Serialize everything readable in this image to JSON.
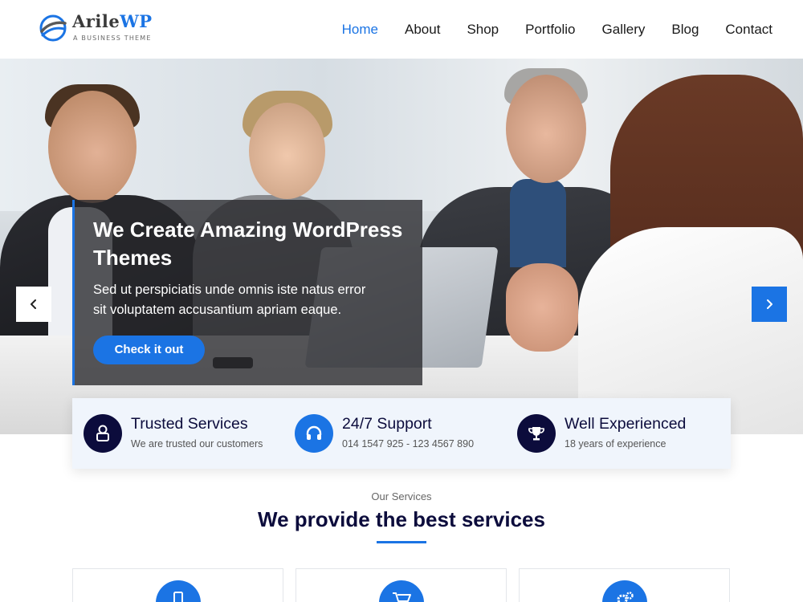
{
  "brand": {
    "name_main": "Arile",
    "name_accent": "WP",
    "tagline": "A BUSINESS THEME",
    "logo_icon": "globe-swoosh-icon",
    "accent_color": "#1b74e4",
    "dark_color": "#0c0c3c"
  },
  "nav": {
    "items": [
      {
        "label": "Home",
        "active": true
      },
      {
        "label": "About",
        "active": false
      },
      {
        "label": "Shop",
        "active": false
      },
      {
        "label": "Portfolio",
        "active": false
      },
      {
        "label": "Gallery",
        "active": false
      },
      {
        "label": "Blog",
        "active": false
      },
      {
        "label": "Contact",
        "active": false
      }
    ]
  },
  "hero": {
    "title": "We Create Amazing WordPress Themes",
    "text": "Sed ut perspiciatis unde omnis iste natus error sit voluptatem accusantium apriam eaque.",
    "button_label": "Check it out",
    "prev_icon": "chevron-left-icon",
    "next_icon": "chevron-right-icon"
  },
  "features": [
    {
      "title": "Trusted Services",
      "subtitle": "We are trusted our customers",
      "icon": "user-lock-icon",
      "icon_bg": "#0c0c3c"
    },
    {
      "title": "24/7 Support",
      "subtitle": "014 1547 925 - 123 4567 890",
      "icon": "headset-icon",
      "icon_bg": "#1b74e4"
    },
    {
      "title": "Well Experienced",
      "subtitle": "18 years of experience",
      "icon": "trophy-icon",
      "icon_bg": "#0c0c3c"
    }
  ],
  "services": {
    "kicker": "Our Services",
    "title_strong": "We provide the",
    "title_rest": " best services",
    "cards": [
      {
        "icon": "mobile-icon"
      },
      {
        "icon": "cart-icon"
      },
      {
        "icon": "gears-icon"
      }
    ]
  }
}
